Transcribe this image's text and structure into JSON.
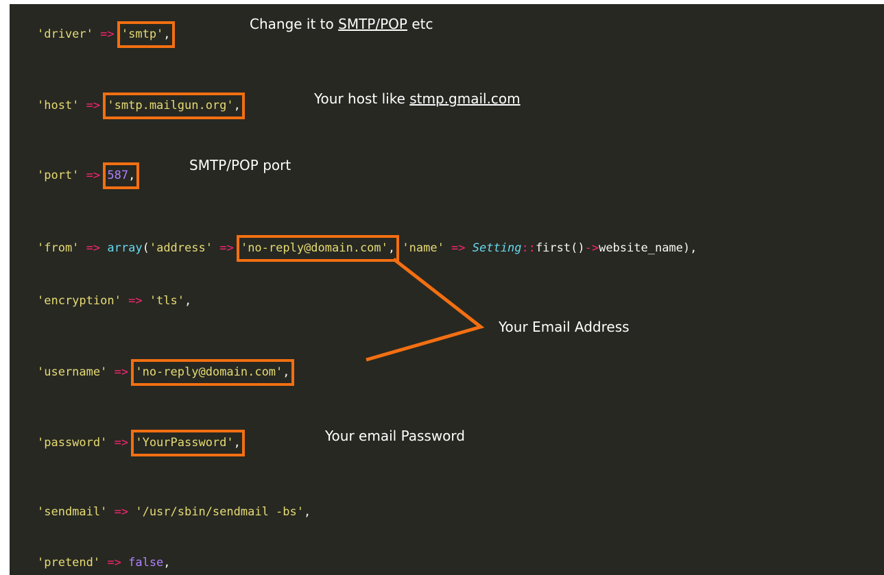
{
  "code": {
    "driver": {
      "key": "'driver'",
      "arrow": "=>",
      "value": "'smtp'",
      "comma": ","
    },
    "host": {
      "key": "'host'",
      "arrow": "=>",
      "value": "'smtp.mailgun.org'",
      "comma": ","
    },
    "port": {
      "key": "'port'",
      "arrow": "=>",
      "value": "587",
      "comma": ","
    },
    "from": {
      "key": "'from'",
      "arrow": "=>",
      "func": "array",
      "open": "(",
      "addr_key": "'address'",
      "addr_arrow": "=>",
      "addr_value": "'no-reply@domain.com'",
      "comma1": ",",
      "name_key": "'name'",
      "name_arrow": "=>",
      "cls": "Setting",
      "scope": "::",
      "method": "first()",
      "arrow2": "->",
      "prop": "website_name",
      "close": "),"
    },
    "encryption": {
      "key": "'encryption'",
      "arrow": "=>",
      "value": "'tls'",
      "comma": ","
    },
    "username": {
      "key": "'username'",
      "arrow": "=>",
      "value": "'no-reply@domain.com'",
      "comma": ","
    },
    "password": {
      "key": "'password'",
      "arrow": "=>",
      "value": "'YourPassword'",
      "comma": ","
    },
    "sendmail": {
      "key": "'sendmail'",
      "arrow": "=>",
      "value": "'/usr/sbin/sendmail -bs'",
      "comma": ","
    },
    "pretend": {
      "key": "'pretend'",
      "arrow": "=>",
      "value": "false",
      "comma": ","
    }
  },
  "annotations": {
    "driver": {
      "prefix": "Change it to ",
      "link": "SMTP/POP",
      "suffix": " etc"
    },
    "host": {
      "prefix": "Your host like ",
      "link": "stmp.gmail.com"
    },
    "port": "SMTP/POP port",
    "email": "Your Email Address",
    "password": "Your email Password"
  },
  "colors": {
    "background": "#272822",
    "string": "#e6db74",
    "operator": "#f92672",
    "number": "#ae81ff",
    "function": "#66d9ef",
    "highlight_box": "#f36f12",
    "annotation_text": "#ffffff"
  }
}
